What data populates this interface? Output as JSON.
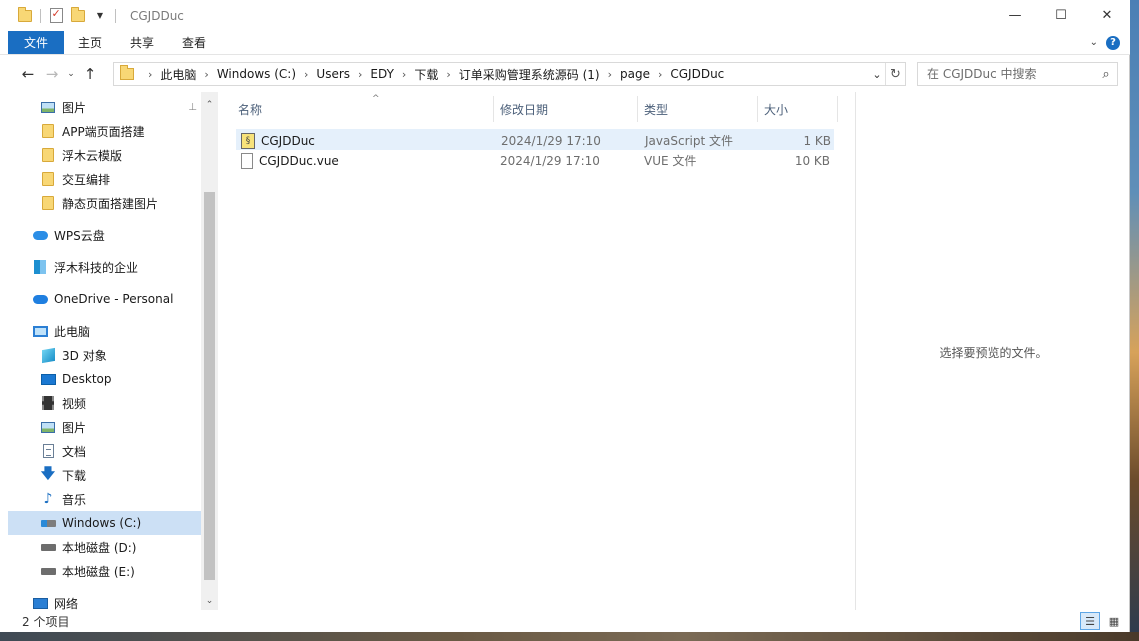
{
  "window": {
    "title": "CGJDDuc",
    "minimize": "—",
    "maximize": "☐",
    "close": "✕"
  },
  "ribbon": {
    "tabs": [
      "文件",
      "主页",
      "共享",
      "查看"
    ],
    "expand": "⌄",
    "help": "?"
  },
  "nav_buttons": {
    "back": "←",
    "forward": "→",
    "recent": "⌄",
    "up": "↑"
  },
  "address": {
    "crumbs": [
      "此电脑",
      "Windows (C:)",
      "Users",
      "EDY",
      "下载",
      "订单采购管理系统源码 (1)",
      "page",
      "CGJDDuc"
    ],
    "separator": "›",
    "dropdown": "⌄",
    "refresh": "↻"
  },
  "search": {
    "placeholder": "在 CGJDDuc 中搜索",
    "value": ""
  },
  "navpane": {
    "items": [
      {
        "label": "图片",
        "icon": "pictures-icon",
        "pinned": true
      },
      {
        "label": "APP端页面搭建",
        "icon": "folder-icon"
      },
      {
        "label": "浮木云模版",
        "icon": "folder-icon"
      },
      {
        "label": "交互编排",
        "icon": "folder-icon"
      },
      {
        "label": "静态页面搭建图片",
        "icon": "folder-icon"
      },
      {
        "label": "WPS云盘",
        "icon": "wps-cloud-icon"
      },
      {
        "label": "浮木科技的企业",
        "icon": "enterprise-icon"
      },
      {
        "label": "OneDrive - Personal",
        "icon": "onedrive-icon"
      },
      {
        "label": "此电脑",
        "icon": "this-pc-icon"
      },
      {
        "label": "3D 对象",
        "icon": "3d-objects-icon"
      },
      {
        "label": "Desktop",
        "icon": "desktop-icon"
      },
      {
        "label": "视频",
        "icon": "videos-icon"
      },
      {
        "label": "图片",
        "icon": "pictures-icon"
      },
      {
        "label": "文档",
        "icon": "documents-icon"
      },
      {
        "label": "下载",
        "icon": "downloads-icon"
      },
      {
        "label": "音乐",
        "icon": "music-icon"
      },
      {
        "label": "Windows (C:)",
        "icon": "windows-drive-icon",
        "selected": true
      },
      {
        "label": "本地磁盘 (D:)",
        "icon": "drive-icon"
      },
      {
        "label": "本地磁盘 (E:)",
        "icon": "drive-icon"
      },
      {
        "label": "网络",
        "icon": "network-icon"
      }
    ],
    "pin_glyph": "📌",
    "scroll_up": "⌃",
    "scroll_down": "⌄"
  },
  "files": {
    "columns": [
      "名称",
      "修改日期",
      "类型",
      "大小"
    ],
    "sort_indicator": "^",
    "rows": [
      {
        "name": "CGJDDuc",
        "date": "2024/1/29 17:10",
        "type": "JavaScript 文件",
        "size": "1 KB",
        "icon": "javascript-file-icon",
        "selected": true
      },
      {
        "name": "CGJDDuc.vue",
        "date": "2024/1/29 17:10",
        "type": "VUE 文件",
        "size": "10 KB",
        "icon": "blank-file-icon"
      }
    ]
  },
  "preview": {
    "empty_text": "选择要预览的文件。"
  },
  "status": {
    "count_text": "2 个项目",
    "details_view": "☰",
    "icons_view": "▦"
  },
  "colors": {
    "accent": "#1a6ec2",
    "selection": "#cce0f5",
    "row_selection": "#e5f0fb"
  }
}
